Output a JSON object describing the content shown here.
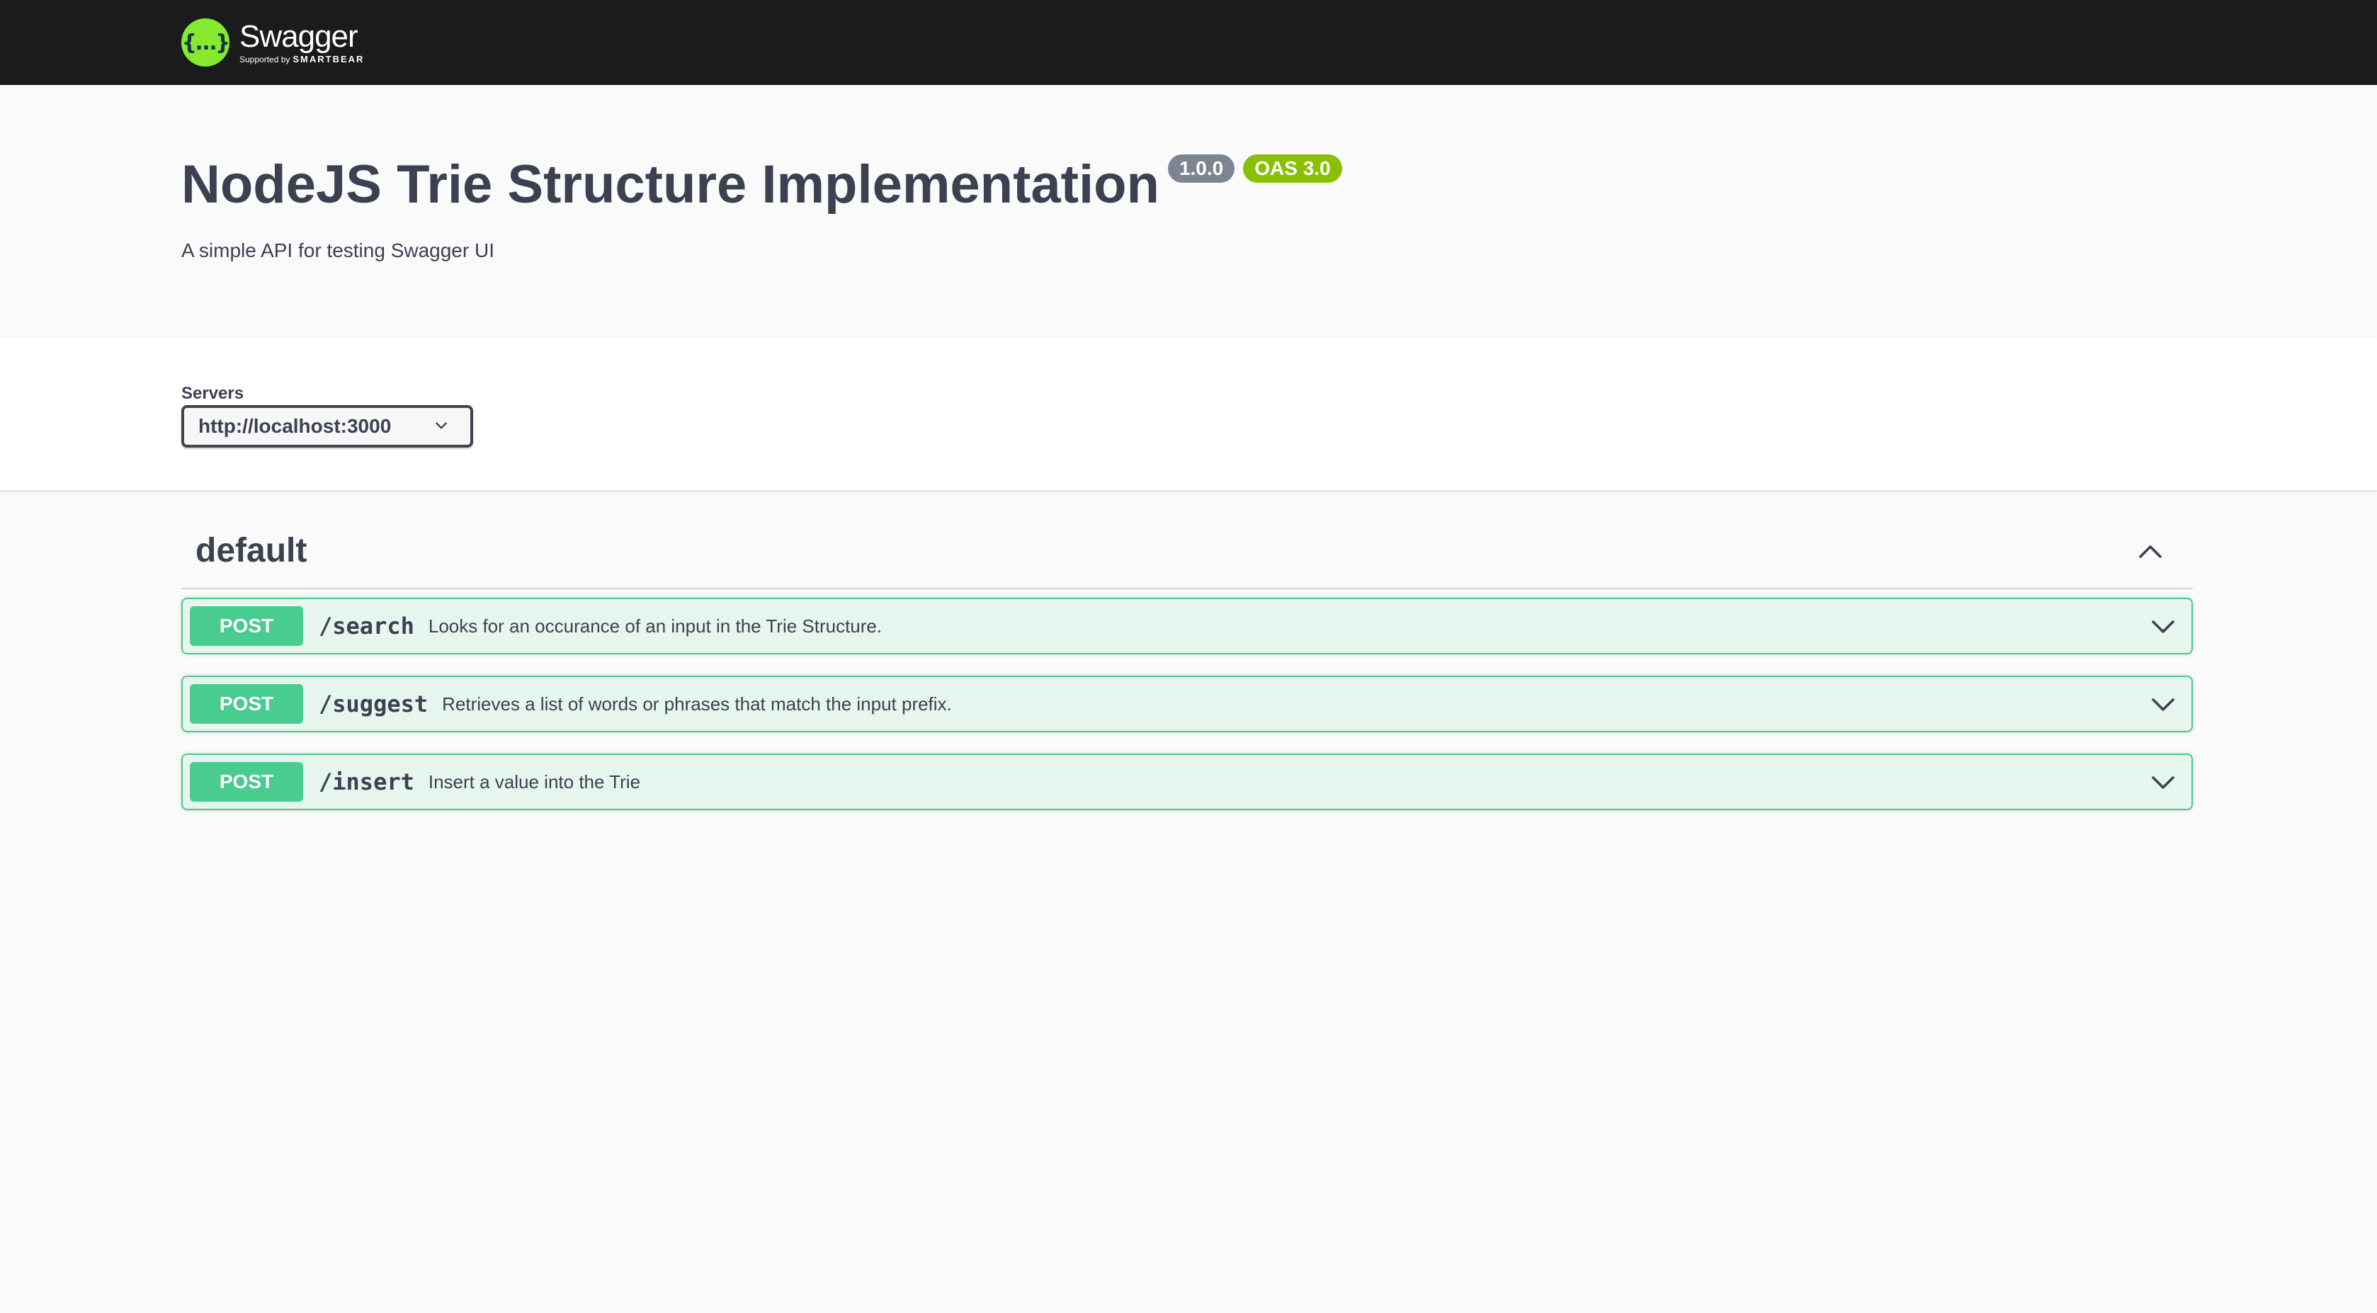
{
  "topbar": {
    "logo_mark": "{…}",
    "logo_name": "Swagger",
    "logo_sub_prefix": "Supported by",
    "logo_sub_brand": "SMARTBEAR"
  },
  "info": {
    "title": "NodeJS Trie Structure Implementation",
    "version_badge": "1.0.0",
    "oas_badge": "OAS 3.0",
    "description": "A simple API for testing Swagger UI"
  },
  "servers": {
    "label": "Servers",
    "selected": "http://localhost:3000"
  },
  "tag": {
    "name": "default",
    "expanded": true
  },
  "operations": [
    {
      "method": "POST",
      "path": "/search",
      "summary": "Looks for an occurance of an input in the Trie Structure."
    },
    {
      "method": "POST",
      "path": "/suggest",
      "summary": "Retrieves a list of words or phrases that match the input prefix."
    },
    {
      "method": "POST",
      "path": "/insert",
      "summary": "Insert a value into the Trie"
    }
  ],
  "colors": {
    "topbar_bg": "#1b1b1b",
    "logo_green": "#85ea2d",
    "post_green": "#49cc90",
    "version_badge": "#7d8492",
    "oas_badge": "#89bf04",
    "text": "#3b4151"
  }
}
